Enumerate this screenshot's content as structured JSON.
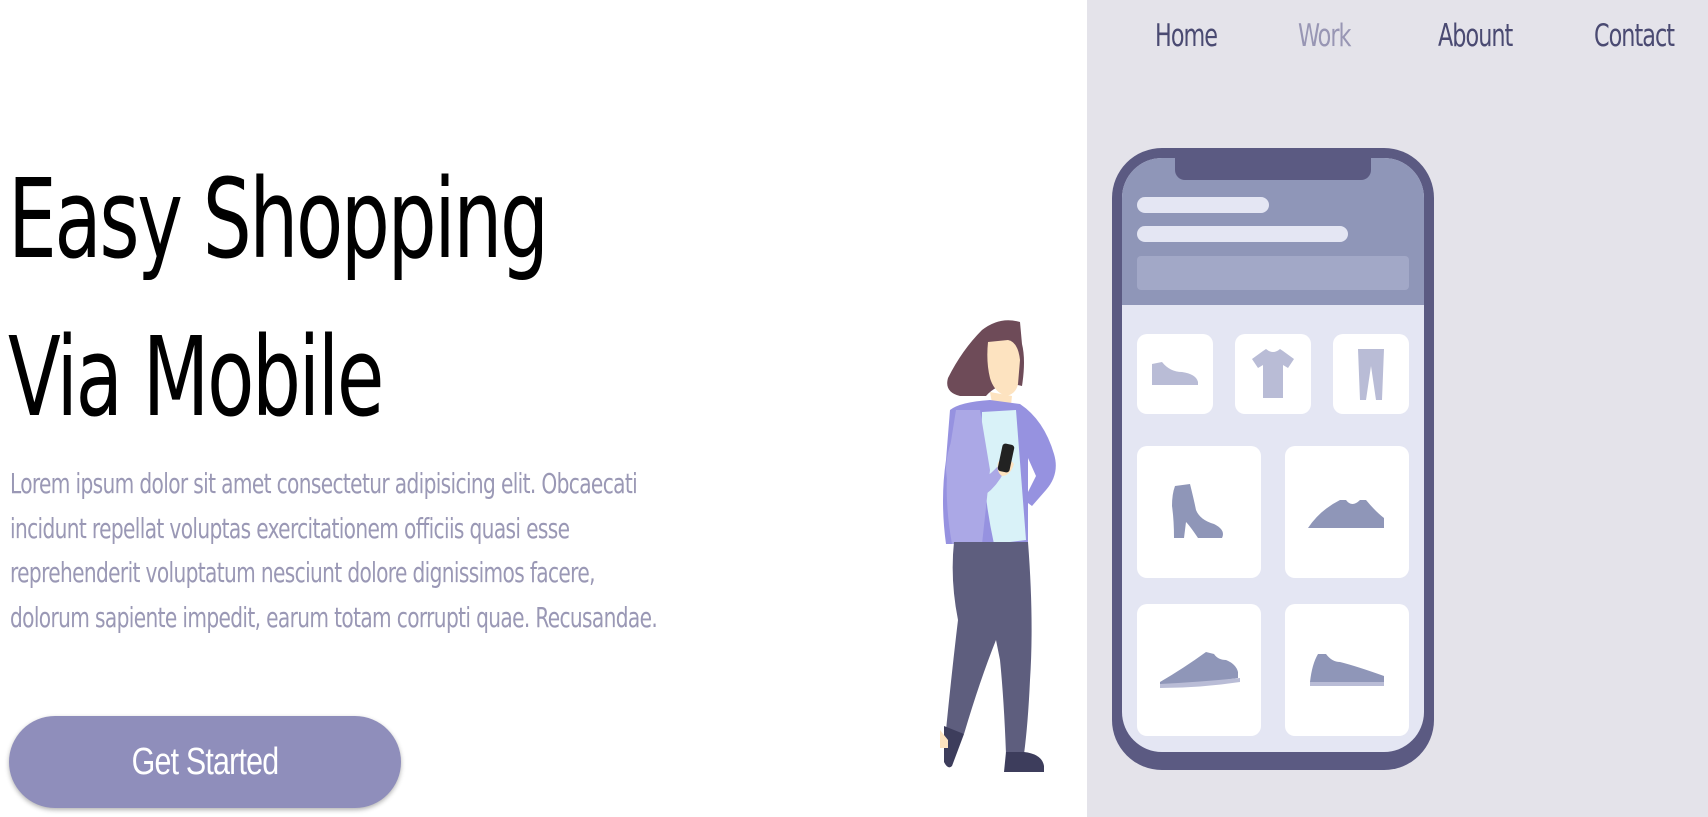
{
  "nav": {
    "items": [
      {
        "label": "Home",
        "active": false
      },
      {
        "label": "Work",
        "active": true
      },
      {
        "label": "Abount",
        "active": false
      },
      {
        "label": "Contact",
        "active": false
      }
    ]
  },
  "hero": {
    "title_line1": "Easy Shopping",
    "title_line2": "Via Mobile",
    "description": "Lorem ipsum dolor sit amet consectetur adipisicing elit. Obcaecati incidunt repellat voluptas exercitationem officiis quasi esse reprehenderit voluptatum nesciunt dolore dignissimos facere, dolorum sapiente impedit, earum totam corrupti quae. Recusandae.",
    "cta_label": "Get Started"
  },
  "colors": {
    "panel_bg": "#e4e3ea",
    "nav_text": "#4a4a72",
    "nav_active": "#9896b4",
    "cta_bg": "#8f8ebb",
    "desc_text": "#9a98b5",
    "phone_frame": "#5b5a82"
  },
  "illustration": {
    "phone_products": [
      "shoe-icon",
      "tshirt-icon",
      "pants-icon",
      "boot-icon",
      "sneaker-icon",
      "sneaker-icon",
      "sneaker-icon"
    ]
  }
}
